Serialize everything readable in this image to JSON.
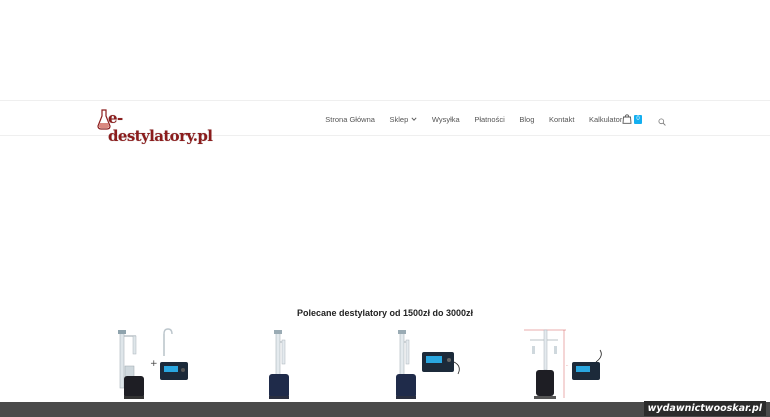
{
  "header": {
    "logo_text": "e-destylatory.pl",
    "nav": [
      {
        "label": "Strona Główna"
      },
      {
        "label": "Sklep"
      },
      {
        "label": "Wysyłka"
      },
      {
        "label": "Płatności"
      },
      {
        "label": "Blog"
      },
      {
        "label": "Kontakt"
      },
      {
        "label": "Kalkulator"
      }
    ],
    "cart_count": "0",
    "icons": {
      "cart": "shopping-bag-icon",
      "search": "search-icon",
      "chevron": "chevron-down-icon"
    }
  },
  "main": {
    "section_title": "Polecane destylatory od 1500zł do 3000zł"
  },
  "footer": {
    "watermark": "wydawnictwooskar.pl"
  },
  "colors": {
    "accent": "#13aff0",
    "logo": "#8b1c1c",
    "footer_bar": "#4a4a4a"
  }
}
